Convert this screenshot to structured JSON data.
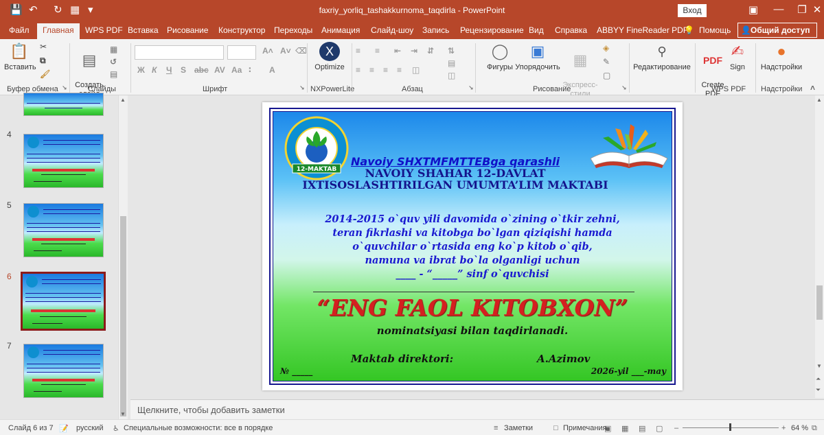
{
  "window": {
    "title": "faxriy_yorliq_tashakkurnoma_taqdirla  -  PowerPoint",
    "signin": "Вход",
    "share": "Общий доступ"
  },
  "menu": {
    "tabs": [
      "Файл",
      "Главная",
      "WPS PDF",
      "Вставка",
      "Рисование",
      "Конструктор",
      "Переходы",
      "Анимация",
      "Слайд-шоу",
      "Запись",
      "Рецензирование",
      "Вид",
      "Справка",
      "ABBYY FineReader PDF"
    ],
    "help": "Помощь"
  },
  "ribbon": {
    "paste": "Вставить",
    "new_slide": "Создать\nслайд",
    "optimize": "Optimize",
    "shapes": "Фигуры",
    "arrange": "Упорядочить",
    "quick_styles": "Экспресс-\nстили",
    "editing": "Редактирование",
    "create_pdf": "Create\nPDF",
    "sign": "Sign",
    "addins": "Надстройки",
    "groups": {
      "clipboard": "Буфер обмена",
      "slides": "Слайды",
      "font": "Шрифт",
      "nxpowerlite": "NXPowerLite",
      "paragraph": "Абзац",
      "drawing": "Рисование",
      "wpspdf": "WPS PDF",
      "addins": "Надстройки"
    }
  },
  "slides_panel": {
    "numbers": [
      "4",
      "5",
      "6",
      "7"
    ],
    "selected": "6"
  },
  "slide": {
    "line1": "Navoiy SHXTMFMTTEBga qarashli",
    "line2": "NAVOIY SHAHAR 12-DAVLAT",
    "line3": "IXTISOSLASHTIRILGAN  UMUMTA’LIM MAKTABI",
    "body1": "2014-2015 o`quv yili davomida o`zining o`tkir zehni,",
    "body2": "teran fikrlashi va kitobga bo`lgan qiziqishi hamda",
    "body3": "o`quvchilar o`rtasida eng ko`p kitob o`qib,",
    "body4": "namuna va ibrat bo`la olganligi uchun",
    "body5": "____ - “_____”  sinf o`quvchisi",
    "big_title": "“ENG FAOL KITOBXON”",
    "nomination": "nominatsiyasi bilan taqdirlanadi.",
    "director_label": "Maktab direktori:",
    "director_name": "A.Azimov",
    "number": "№ _____",
    "date": "2026-yil ___-may",
    "logo_text": "12-MAKTAB"
  },
  "notes": {
    "placeholder": "Щелкните, чтобы добавить заметки"
  },
  "status": {
    "slide_of": "Слайд 6 из 7",
    "language": "русский",
    "accessibility": "Специальные возможности: все в порядке",
    "notes": "Заметки",
    "comments": "Примечания",
    "zoom": "64 %"
  },
  "colors": {
    "accent": "#b7472a",
    "slide_title": "#1010c8",
    "big_title": "#d42020"
  }
}
